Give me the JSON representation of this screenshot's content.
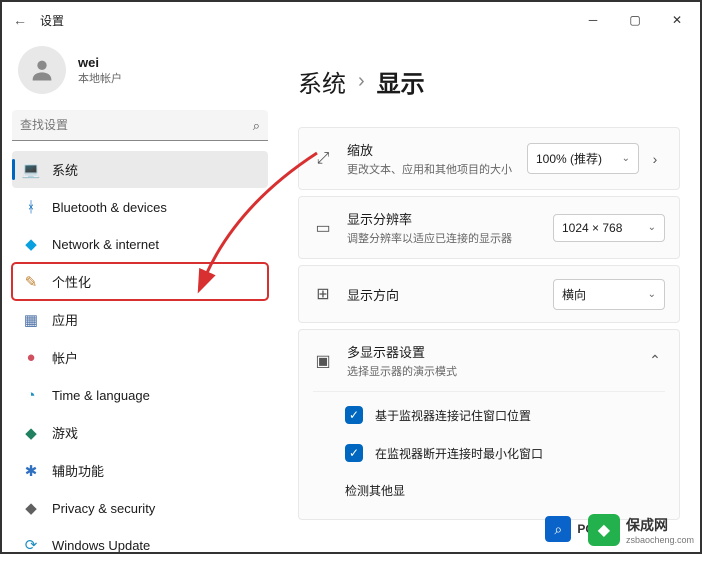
{
  "titlebar": {
    "title": "设置"
  },
  "user": {
    "name": "wei",
    "type": "本地帐户"
  },
  "search": {
    "placeholder": "查找设置"
  },
  "nav": [
    {
      "icon": "💻",
      "label": "系统",
      "color": "#0067c0"
    },
    {
      "icon": "ᚼ",
      "label": "Bluetooth & devices",
      "color": "#0067c0"
    },
    {
      "icon": "◆",
      "label": "Network & internet",
      "color": "#0aa0e0"
    },
    {
      "icon": "✎",
      "label": "个性化",
      "color": "#c08030"
    },
    {
      "icon": "▦",
      "label": "应用",
      "color": "#4a6fa5"
    },
    {
      "icon": "●",
      "label": "帐户",
      "color": "#d05060"
    },
    {
      "icon": "◔",
      "label": "Time & language",
      "color": "#2090c0"
    },
    {
      "icon": "◆",
      "label": "游戏",
      "color": "#208060"
    },
    {
      "icon": "✱",
      "label": "辅助功能",
      "color": "#3070c0"
    },
    {
      "icon": "◆",
      "label": "Privacy & security",
      "color": "#606060"
    },
    {
      "icon": "⟳",
      "label": "Windows Update",
      "color": "#2090c0"
    }
  ],
  "breadcrumb": {
    "parent": "系统",
    "current": "显示"
  },
  "scale": {
    "title": "缩放",
    "sub": "更改文本、应用和其他项目的大小",
    "value": "100% (推荐)"
  },
  "resolution": {
    "title": "显示分辨率",
    "sub": "调整分辨率以适应已连接的显示器",
    "value": "1024 × 768"
  },
  "orientation": {
    "title": "显示方向",
    "value": "横向"
  },
  "multi": {
    "title": "多显示器设置",
    "sub": "选择显示器的演示模式",
    "opt1": "基于监视器连接记住窗口位置",
    "opt2": "在监视器断开连接时最小化窗口",
    "detect": "检测其他显"
  },
  "watermark": {
    "brand": "保成网",
    "url": "zsbaocheng.com"
  },
  "pc": {
    "label": "PC"
  }
}
